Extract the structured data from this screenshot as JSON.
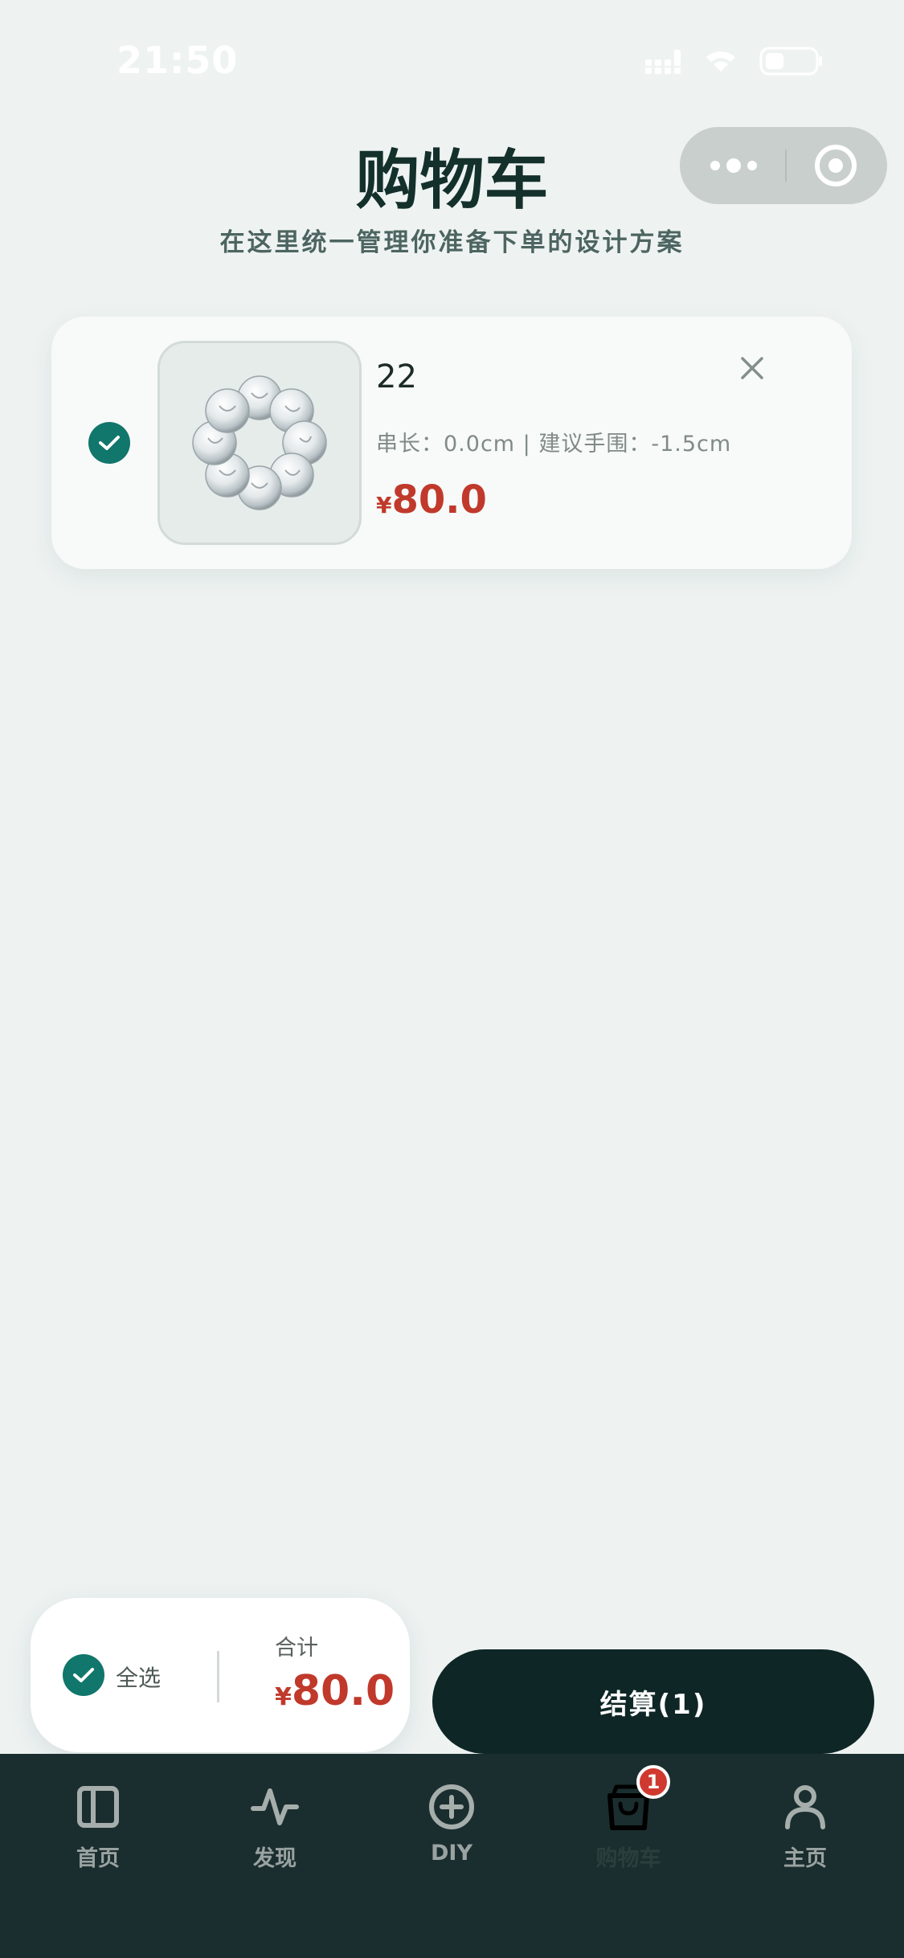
{
  "status_bar": {
    "time": "21:50"
  },
  "header": {
    "title": "购物车",
    "subtitle": "在这里统一管理你准备下单的设计方案"
  },
  "cart": {
    "items": [
      {
        "name": "22",
        "spec": "串长：0.0cm | 建议手围：-1.5cm",
        "currency": "¥",
        "price": "80.0",
        "selected": true
      }
    ]
  },
  "summary": {
    "select_all_label": "全选",
    "total_label": "合计",
    "currency": "¥",
    "total": "80.0"
  },
  "checkout": {
    "label": "结算(1)"
  },
  "tabbar": {
    "tabs": [
      {
        "label": "首页",
        "icon": "sidebar-panel-icon"
      },
      {
        "label": "发现",
        "icon": "activity-pulse-icon"
      },
      {
        "label": "DIY",
        "icon": "plus-circle-icon"
      },
      {
        "label": "购物车",
        "icon": "shopping-bag-icon",
        "active": true,
        "badge": "1"
      },
      {
        "label": "主页",
        "icon": "user-icon"
      }
    ]
  },
  "colors": {
    "accent": "#11766b",
    "price": "#c0392b",
    "dark": "#0f2626",
    "tabbar_bg": "#1b2e2f",
    "background": "#eef3f2"
  }
}
